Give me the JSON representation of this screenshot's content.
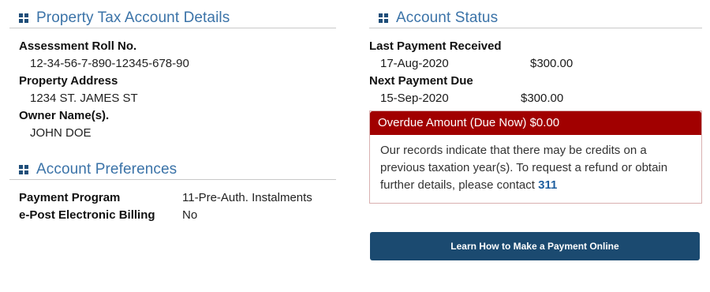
{
  "property_details": {
    "title": "Property Tax Account Details",
    "assessment_label": "Assessment Roll No.",
    "assessment_value": "12-34-56-7-890-12345-678-90",
    "address_label": "Property Address",
    "address_value": "1234 ST. JAMES ST",
    "owner_label": "Owner Name(s).",
    "owner_value": "JOHN DOE"
  },
  "preferences": {
    "title": "Account Preferences",
    "rows": [
      {
        "label": "Payment Program",
        "value": "11-Pre-Auth. Instalments"
      },
      {
        "label": "e-Post Electronic Billing",
        "value": "No"
      }
    ]
  },
  "status": {
    "title": "Account Status",
    "last_payment_label": "Last Payment Received",
    "last_payment_date": "17-Aug-2020",
    "last_payment_amount": "$300.00",
    "next_payment_label": "Next Payment Due",
    "next_payment_date": "15-Sep-2020",
    "next_payment_amount": "$300.00"
  },
  "overdue": {
    "title": "Overdue Amount (Due Now) $0.00",
    "message": "Our records indicate that there may be credits on a previous taxation year(s). To request a refund or obtain further details, please contact",
    "contact_link": "311"
  },
  "payment_button_label": "Learn How to Make a Payment Online",
  "colors": {
    "title_blue": "#3b73a8",
    "icon_navy": "#1f4e79",
    "alert_red": "#a10000",
    "button_navy": "#1b4a70"
  }
}
